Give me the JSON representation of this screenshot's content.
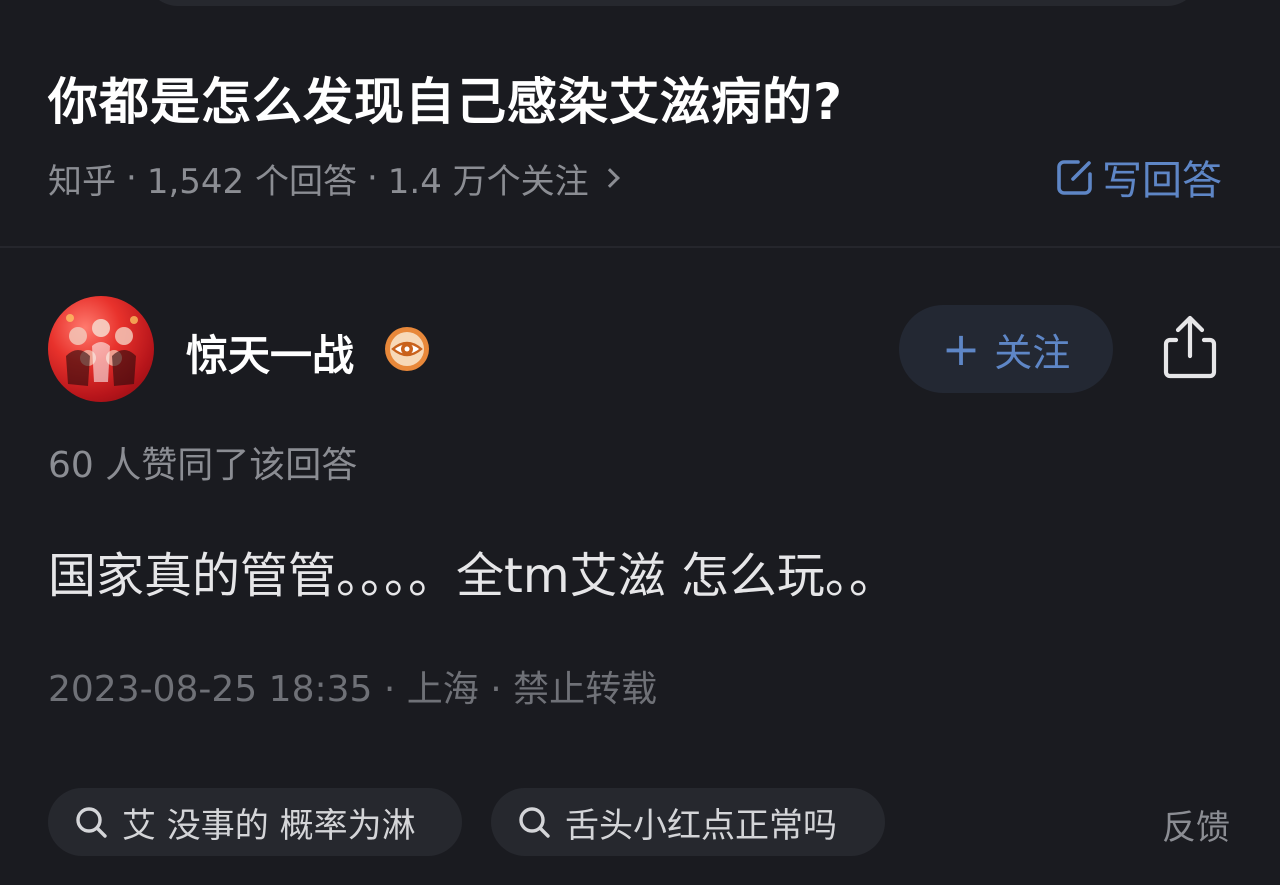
{
  "question": {
    "title": "你都是怎么发现自己感染艾滋病的?",
    "source": "知乎",
    "answers_count": "1,542 个回答",
    "followers_count": "1.4 万个关注",
    "write_answer_label": "写回答"
  },
  "answer": {
    "author_name": "惊天一战",
    "follow_label": "关注",
    "upvote_text": "60 人赞同了该回答",
    "body": "国家真的管管。。。。全tm艾滋 怎么玩。。",
    "date": "2023-08-25 18:35",
    "location": "上海",
    "copyright": "禁止转载"
  },
  "related_searches": [
    {
      "label": "艾 没事的 概率为淋"
    },
    {
      "label": "舌头小红点正常吗"
    }
  ],
  "feedback_label": "反馈",
  "colors": {
    "background": "#1a1b20",
    "accent": "#5e86c6",
    "muted": "#8b8d93",
    "chip_bg": "#26282e",
    "badge": "#e8883a"
  },
  "icons": {
    "write": "edit-square-icon",
    "follow": "plus-icon",
    "share": "share-icon",
    "badge": "eye-badge-icon",
    "search": "search-icon",
    "chevron": "chevron-right-icon"
  }
}
